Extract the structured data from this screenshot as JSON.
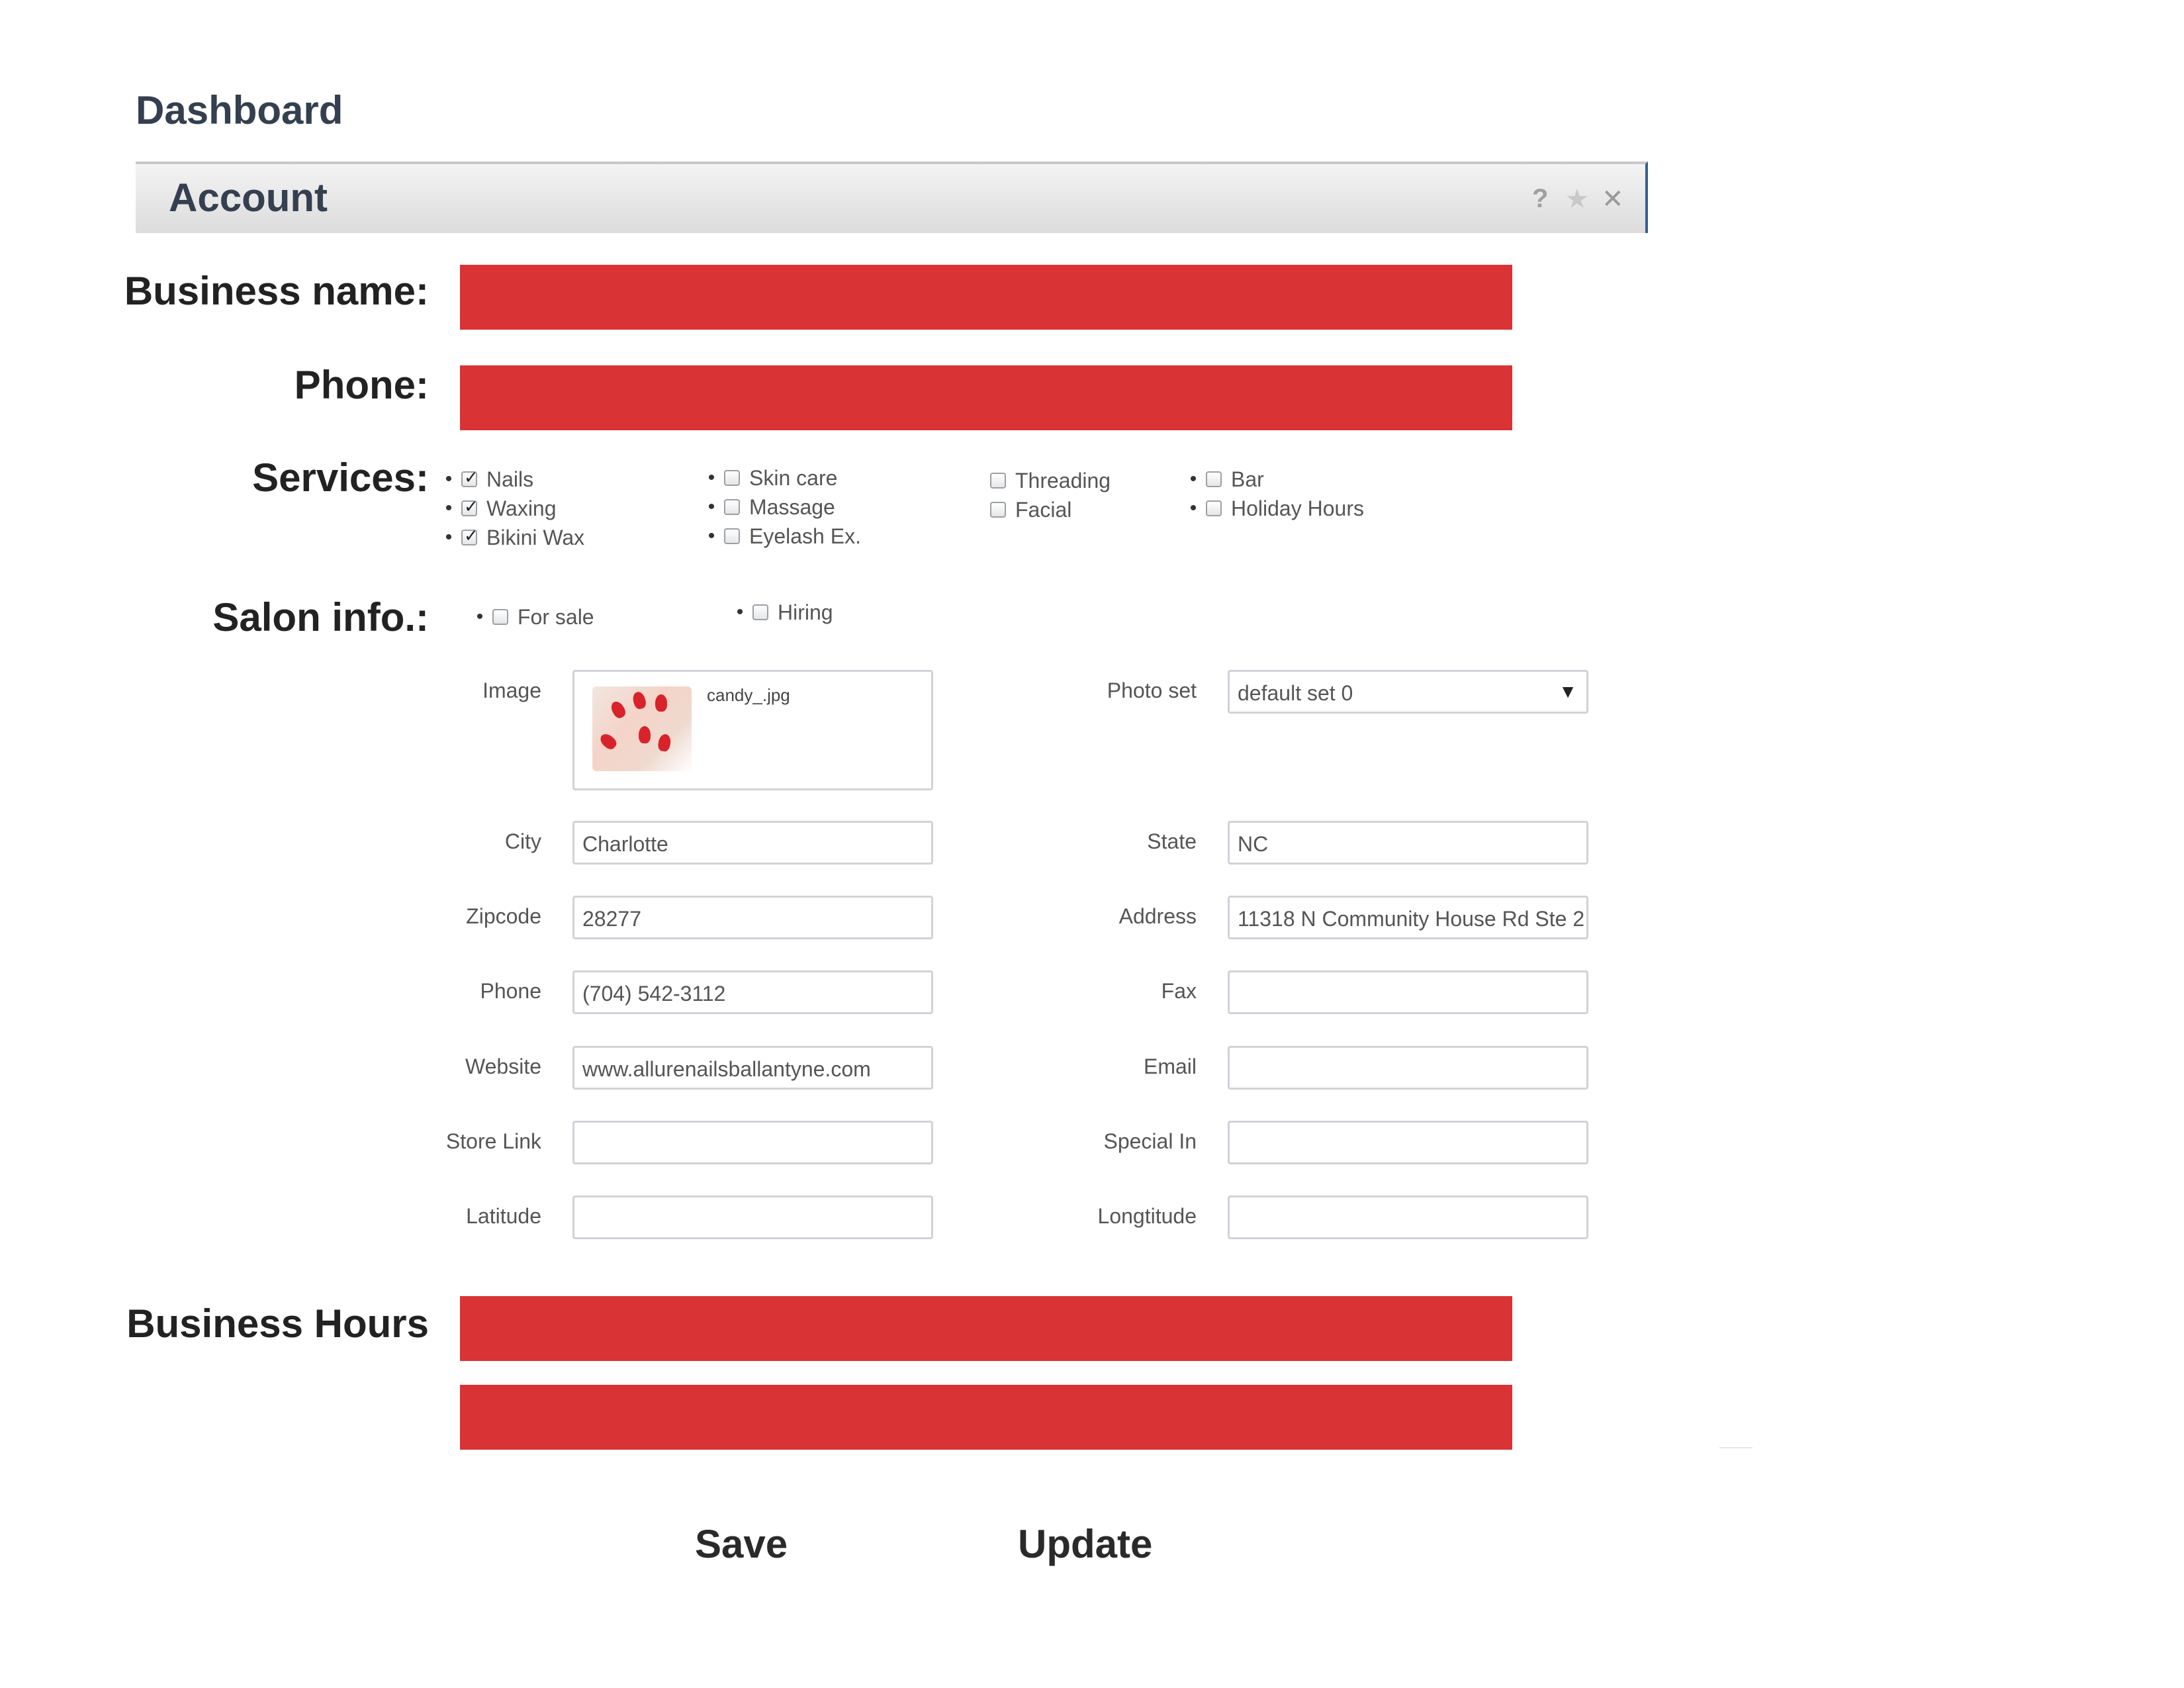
{
  "header": {
    "dashboard": "Dashboard",
    "panel_title": "Account",
    "help_icon": "?",
    "star_icon": "★",
    "close_icon": "✕"
  },
  "labels": {
    "business_name": "Business name:",
    "phone": "Phone:",
    "services": "Services:",
    "salon_info": "Salon info.:",
    "business_hours": "Business Hours"
  },
  "services": {
    "col1": [
      {
        "label": "Nails",
        "checked": true
      },
      {
        "label": "Waxing",
        "checked": true
      },
      {
        "label": "Bikini Wax",
        "checked": true
      }
    ],
    "col2": [
      {
        "label": "Skin care",
        "checked": false
      },
      {
        "label": "Massage",
        "checked": false
      },
      {
        "label": "Eyelash Ex.",
        "checked": false
      }
    ],
    "col3": [
      {
        "label": "Threading",
        "checked": false
      },
      {
        "label": "Facial",
        "checked": false
      }
    ],
    "col4": [
      {
        "label": "Bar",
        "checked": false
      },
      {
        "label": "Holiday Hours",
        "checked": false
      }
    ]
  },
  "salon_info": [
    {
      "label": "For sale",
      "checked": false
    },
    {
      "label": "Hiring",
      "checked": false
    }
  ],
  "form": {
    "image_label": "Image",
    "image_name": "candy_.jpg",
    "photo_set_label": "Photo set",
    "photo_set_value": "default set 0",
    "city_label": "City",
    "city_value": "Charlotte",
    "state_label": "State",
    "state_value": "NC",
    "zip_label": "Zipcode",
    "zip_value": "28277",
    "address_label": "Address",
    "address_value": "11318 N Community House Rd Ste 2",
    "phone_label": "Phone",
    "phone_value": "(704) 542-3112",
    "fax_label": "Fax",
    "fax_value": "",
    "website_label": "Website",
    "website_value": "www.allurenailsballantyne.com",
    "email_label": "Email",
    "email_value": "",
    "storelink_label": "Store Link",
    "storelink_value": "",
    "specialin_label": "Special In",
    "specialin_value": "",
    "latitude_label": "Latitude",
    "latitude_value": "",
    "longitude_label": "Longtitude",
    "longitude_value": ""
  },
  "buttons": {
    "save": "Save",
    "update": "Update"
  },
  "colors": {
    "redacted": "#d93335",
    "title_text": "#34404f"
  }
}
